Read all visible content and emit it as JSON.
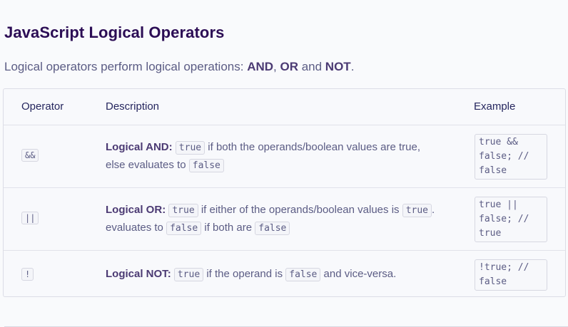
{
  "heading": "JavaScript Logical Operators",
  "intro": {
    "prefix": "Logical operators perform logical operations: ",
    "and": "AND",
    "sep1": ", ",
    "or": "OR",
    "sep2": " and ",
    "not": "NOT",
    "suffix": "."
  },
  "table": {
    "headers": [
      "Operator",
      "Description",
      "Example"
    ],
    "rows": [
      {
        "operator": "&&",
        "name": "Logical AND",
        "colon": ":",
        "code1": "true",
        "text1": " if both the operands/boolean values are true, else evaluates to ",
        "code2": "false",
        "example": "true &&\nfalse; //\nfalse"
      },
      {
        "operator": "||",
        "name": "Logical OR",
        "colon": ":",
        "code1": "true",
        "text1": " if either of the operands/boolean values is ",
        "code2": "true",
        "text2": ". evaluates to ",
        "code3": "false",
        "text3": " if both are ",
        "code4": "false",
        "example": "true ||\nfalse; //\ntrue"
      },
      {
        "operator": "!",
        "name": "Logical NOT",
        "colon": ":",
        "code1": "true",
        "text1": " if the operand is ",
        "code2": "false",
        "text2": " and vice-versa.",
        "example": "!true; //\nfalse"
      }
    ]
  }
}
